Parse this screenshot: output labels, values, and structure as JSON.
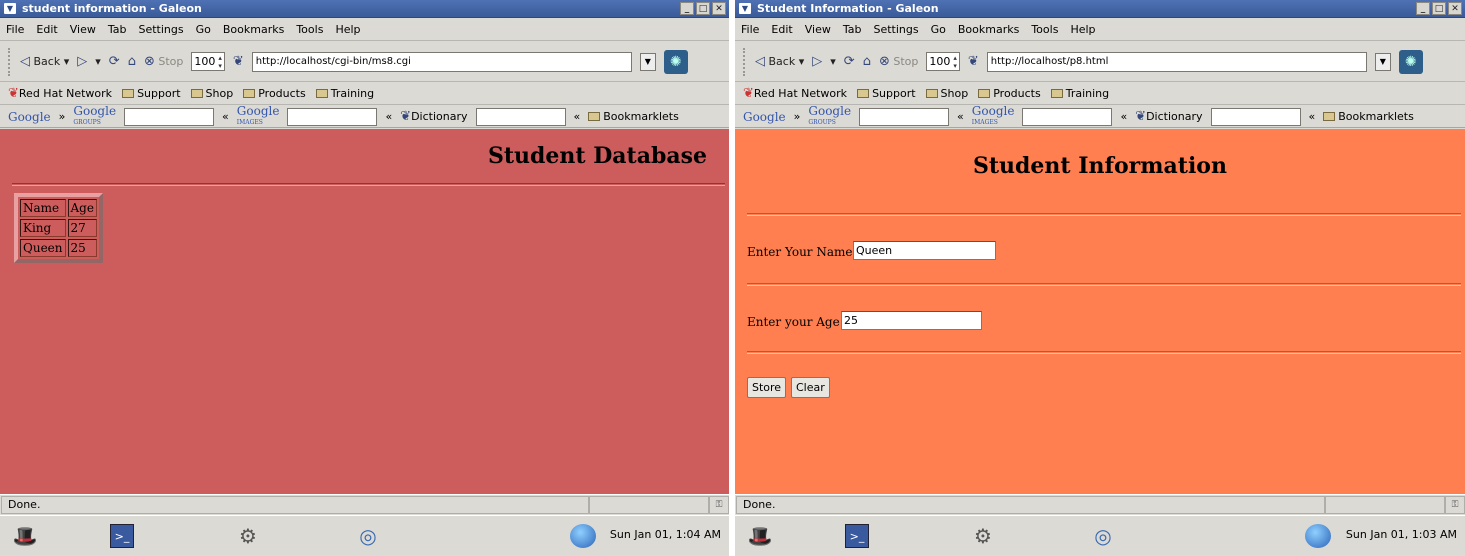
{
  "left": {
    "title": "student information - Galeon",
    "menu": [
      "File",
      "Edit",
      "View",
      "Tab",
      "Settings",
      "Go",
      "Bookmarks",
      "Tools",
      "Help"
    ],
    "toolbar": {
      "back": "Back",
      "stop": "Stop",
      "zoom": "100",
      "url": "http://localhost/cgi-bin/ms8.cgi"
    },
    "bookmarks": [
      "Red Hat Network",
      "Support",
      "Shop",
      "Products",
      "Training"
    ],
    "google_bar": {
      "google": "Google",
      "groups": "GROUPS",
      "images": "IMAGES",
      "dictionary": "Dictionary",
      "bookmarklets": "Bookmarklets",
      "sep_right": "»",
      "sep_left": "«"
    },
    "page": {
      "heading": "Student Database",
      "table": {
        "headers": [
          "Name",
          "Age"
        ],
        "rows": [
          [
            "King",
            "27"
          ],
          [
            "Queen",
            "25"
          ]
        ]
      }
    },
    "status": "Done.",
    "clock": "Sun Jan 01,  1:04 AM"
  },
  "right": {
    "title": "Student Information - Galeon",
    "menu": [
      "File",
      "Edit",
      "View",
      "Tab",
      "Settings",
      "Go",
      "Bookmarks",
      "Tools",
      "Help"
    ],
    "toolbar": {
      "back": "Back",
      "stop": "Stop",
      "zoom": "100",
      "url": "http://localhost/p8.html"
    },
    "bookmarks": [
      "Red Hat Network",
      "Support",
      "Shop",
      "Products",
      "Training"
    ],
    "google_bar": {
      "google": "Google",
      "groups": "GROUPS",
      "images": "IMAGES",
      "dictionary": "Dictionary",
      "bookmarklets": "Bookmarklets",
      "sep_right": "»",
      "sep_left": "«"
    },
    "page": {
      "heading": "Student Information",
      "name_label": "Enter Your Name:",
      "name_value": "Queen",
      "age_label": "Enter your Age:",
      "age_value": "25",
      "store_label": "Store",
      "clear_label": "Clear"
    },
    "status": "Done.",
    "clock": "Sun Jan 01,  1:03 AM"
  },
  "colors": {
    "left_bg": "#cd5c5c",
    "right_bg": "#ff7f50",
    "titlebar": "#3a5a98"
  }
}
